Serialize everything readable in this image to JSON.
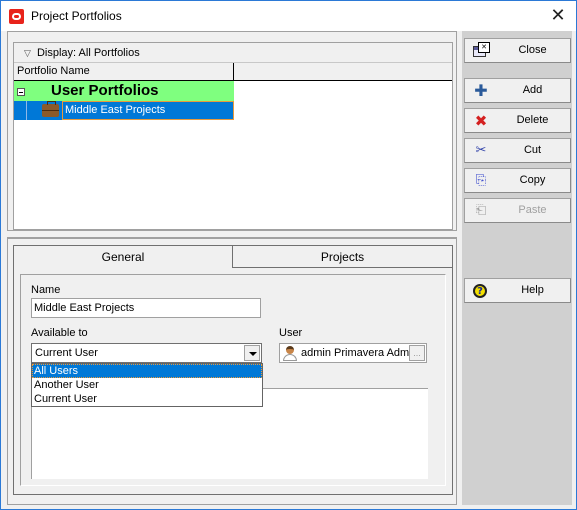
{
  "window": {
    "title": "Project Portfolios",
    "close_glyph": "✕"
  },
  "portfolio_list": {
    "display_label": "Display: All Portfolios",
    "display_glyph": "▽",
    "column_header": "Portfolio Name",
    "group_label": "User Portfolios",
    "group_color": "#7fff7f",
    "items": [
      {
        "name": "Middle East Projects",
        "selected": true
      }
    ],
    "selection_color": "#0078d7"
  },
  "tabs": [
    {
      "label": "General",
      "active": true
    },
    {
      "label": "Projects",
      "active": false
    }
  ],
  "general": {
    "name_label": "Name",
    "name_value": "Middle East Projects",
    "available_to_label": "Available to",
    "available_to_value": "Current User",
    "available_to_options": [
      "All Users",
      "Another User",
      "Current User"
    ],
    "available_to_highlighted": "All Users",
    "user_label": "User",
    "user_value": "admin Primavera Admir",
    "user_browse_glyph": "..."
  },
  "buttons": {
    "close": {
      "label": "Close"
    },
    "add": {
      "label": "Add",
      "glyph": "✚"
    },
    "delete": {
      "label": "Delete",
      "glyph": "✖"
    },
    "cut": {
      "label": "Cut",
      "glyph": "✂"
    },
    "copy": {
      "label": "Copy",
      "glyph": "⎘"
    },
    "paste": {
      "label": "Paste",
      "glyph": "⎗",
      "disabled": true
    },
    "help": {
      "label": "Help",
      "glyph": "?"
    }
  }
}
